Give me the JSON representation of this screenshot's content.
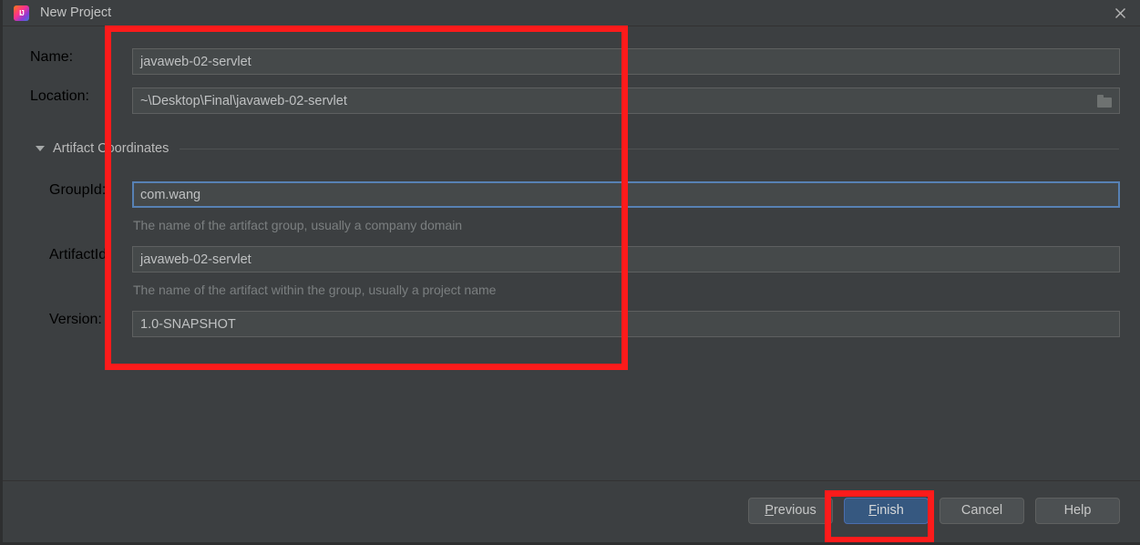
{
  "window": {
    "title": "New Project",
    "app_icon": "intellij-idea-icon",
    "close_icon": "close-icon",
    "background_color": "#3c3f41"
  },
  "form": {
    "name_row": {
      "label": "Name:",
      "value": "javaweb-02-servlet"
    },
    "location_row": {
      "label": "Location:",
      "value": "~\\Desktop\\Final\\javaweb-02-servlet",
      "browse_icon": "folder-icon"
    },
    "section": {
      "label": "Artifact Coordinates",
      "expander_icon": "triangle-down-icon"
    },
    "groupid_row": {
      "label": "GroupId:",
      "value": "com.wang",
      "hint": "The name of the artifact group, usually a company domain",
      "focused": true
    },
    "artifactid_row": {
      "label": "ArtifactId:",
      "value": "javaweb-02-servlet",
      "hint": "The name of the artifact within the group, usually a project name"
    },
    "version_row": {
      "label": "Version:",
      "value": "1.0-SNAPSHOT"
    }
  },
  "buttons": {
    "previous": {
      "prefix": "P",
      "rest": "revious"
    },
    "finish": {
      "prefix": "F",
      "rest": "inish"
    },
    "cancel": {
      "label": "Cancel"
    },
    "help": {
      "label": "Help"
    }
  },
  "annotations": {
    "fields_highlight": "red-rectangle-fields",
    "finish_highlight": "red-rectangle-finish",
    "color": "#fc1b1b"
  }
}
